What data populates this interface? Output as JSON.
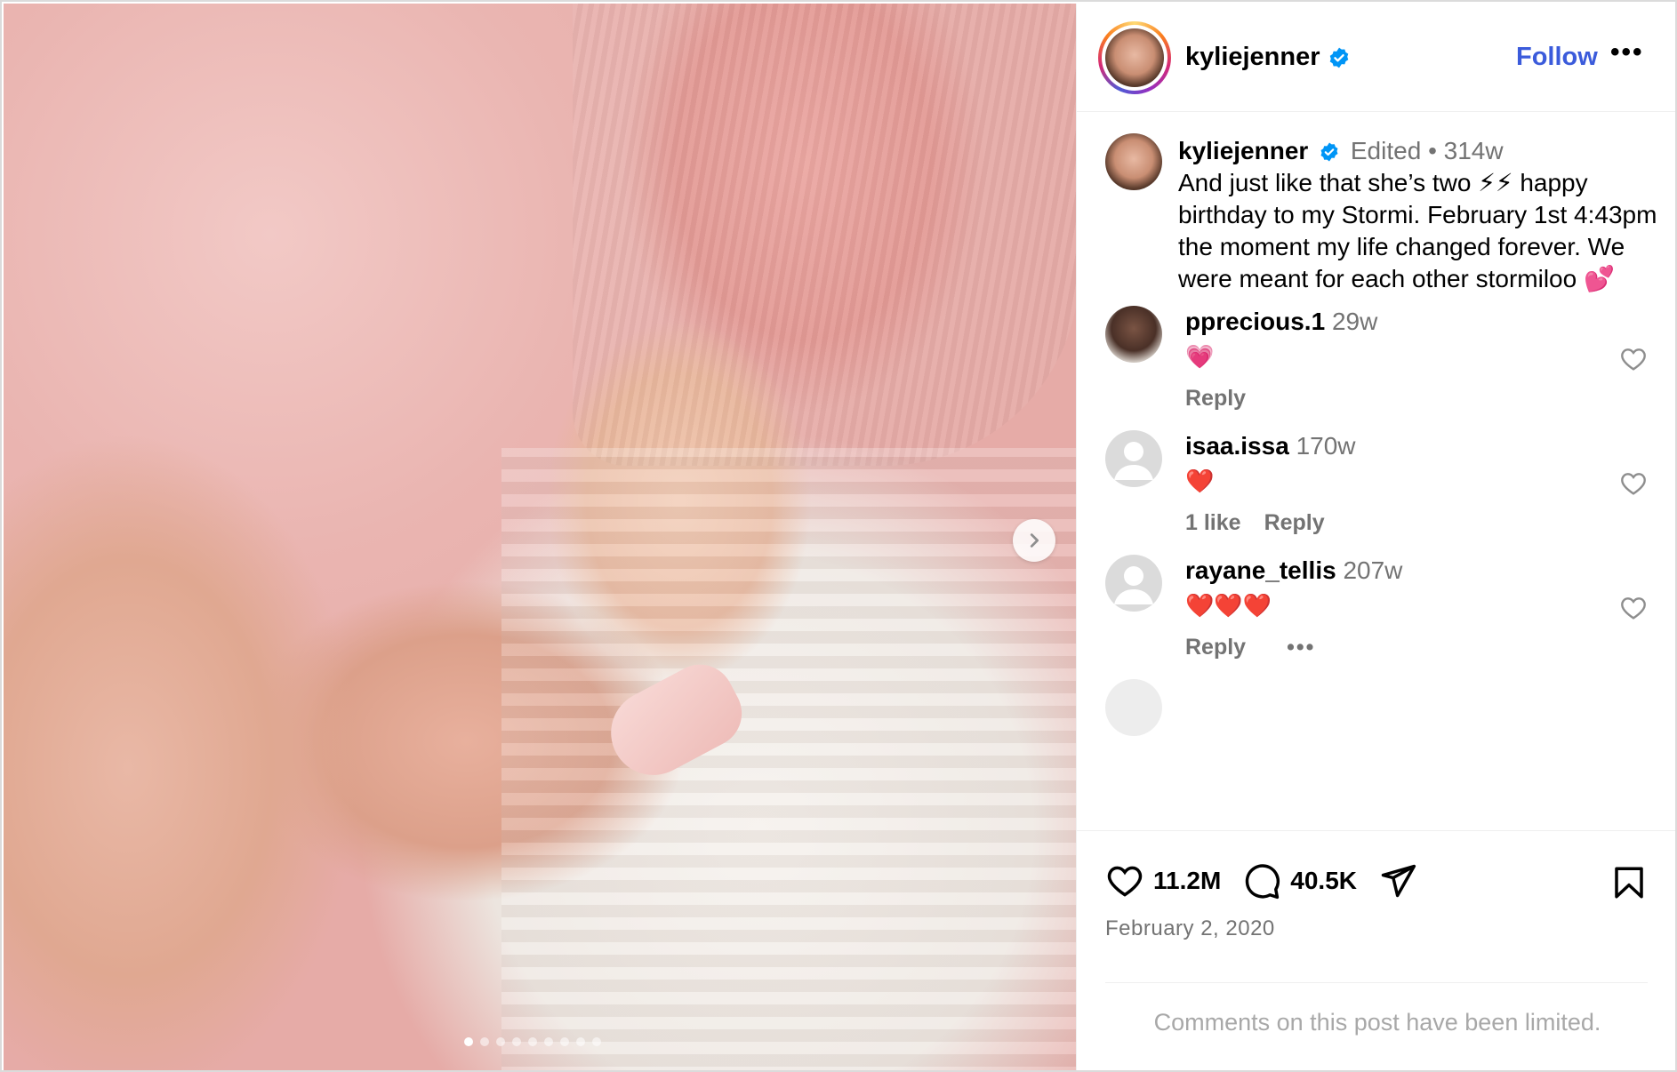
{
  "post": {
    "username": "kyliejenner",
    "follow_label": "Follow",
    "more_label": "•••",
    "caption": {
      "username": "kyliejenner",
      "edited": "Edited",
      "separator": "•",
      "time": "314w",
      "text": "And just like that she’s two ⚡⚡ happy birthday to my Stormi. February 1st 4:43pm the moment my life changed forever. We were meant for each other stormiloo 💕"
    },
    "comments": [
      {
        "username": "pprecious.1",
        "time": "29w",
        "text": "💗",
        "likes": "",
        "reply": "Reply"
      },
      {
        "username": "isaa.issa",
        "time": "170w",
        "text": "❤️",
        "likes": "1 like",
        "reply": "Reply"
      },
      {
        "username": "rayane_tellis",
        "time": "207w",
        "text": "❤️❤️❤️",
        "likes": "",
        "reply": "Reply",
        "more": "•••"
      }
    ],
    "stats": {
      "likes": "11.2M",
      "comments": "40.5K"
    },
    "date": "February 2, 2020",
    "comments_limited": "Comments on this post have been limited."
  },
  "carousel": {
    "total": 9,
    "active": 1
  },
  "colors": {
    "follow": "#3b5bdb",
    "verified": "#0095f6",
    "muted": "#737373"
  },
  "icons": [
    "verified-icon",
    "more-icon",
    "heart-icon",
    "comment-icon",
    "share-icon",
    "bookmark-icon",
    "chevron-right-icon"
  ]
}
